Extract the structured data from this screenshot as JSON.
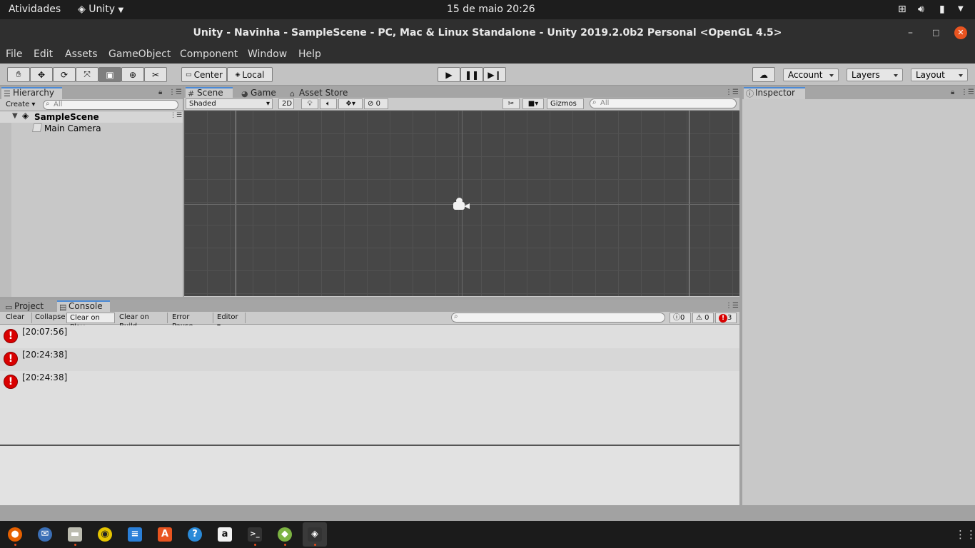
{
  "topbar": {
    "activities": "Atividades",
    "app_menu": "Unity",
    "clock": "15 de maio  20:26"
  },
  "window": {
    "title": "Unity - Navinha - SampleScene - PC, Mac & Linux Standalone - Unity 2019.2.0b2 Personal <OpenGL 4.5>"
  },
  "menu": [
    "File",
    "Edit",
    "Assets",
    "GameObject",
    "Component",
    "Window",
    "Help"
  ],
  "toolbar": {
    "center_label": "Center",
    "local_label": "Local",
    "account_label": "Account",
    "layers_label": "Layers",
    "layout_label": "Layout"
  },
  "hierarchy": {
    "tab": "Hierarchy",
    "create_label": "Create",
    "search_placeholder": "All",
    "scene_name": "SampleScene",
    "items": [
      "Main Camera"
    ]
  },
  "scene": {
    "tabs": [
      "Scene",
      "Game",
      "Asset Store"
    ],
    "shading": "Shaded",
    "mode_2d": "2D",
    "hidden_count": "0",
    "gizmos_label": "Gizmos",
    "search_placeholder": "All"
  },
  "inspector": {
    "tab": "Inspector"
  },
  "console": {
    "tabs": [
      "Project",
      "Console"
    ],
    "buttons": [
      "Clear",
      "Collapse",
      "Clear on Play",
      "Clear on Build",
      "Error Pause",
      "Editor"
    ],
    "info_count": "0",
    "warning_count": "0",
    "error_count": "3",
    "entries": [
      "[20:07:56]",
      "[20:24:38]",
      "[20:24:38]"
    ]
  },
  "colors": {
    "accent": "#4b8ad6",
    "error": "#d90000",
    "close_button": "#e95420"
  }
}
